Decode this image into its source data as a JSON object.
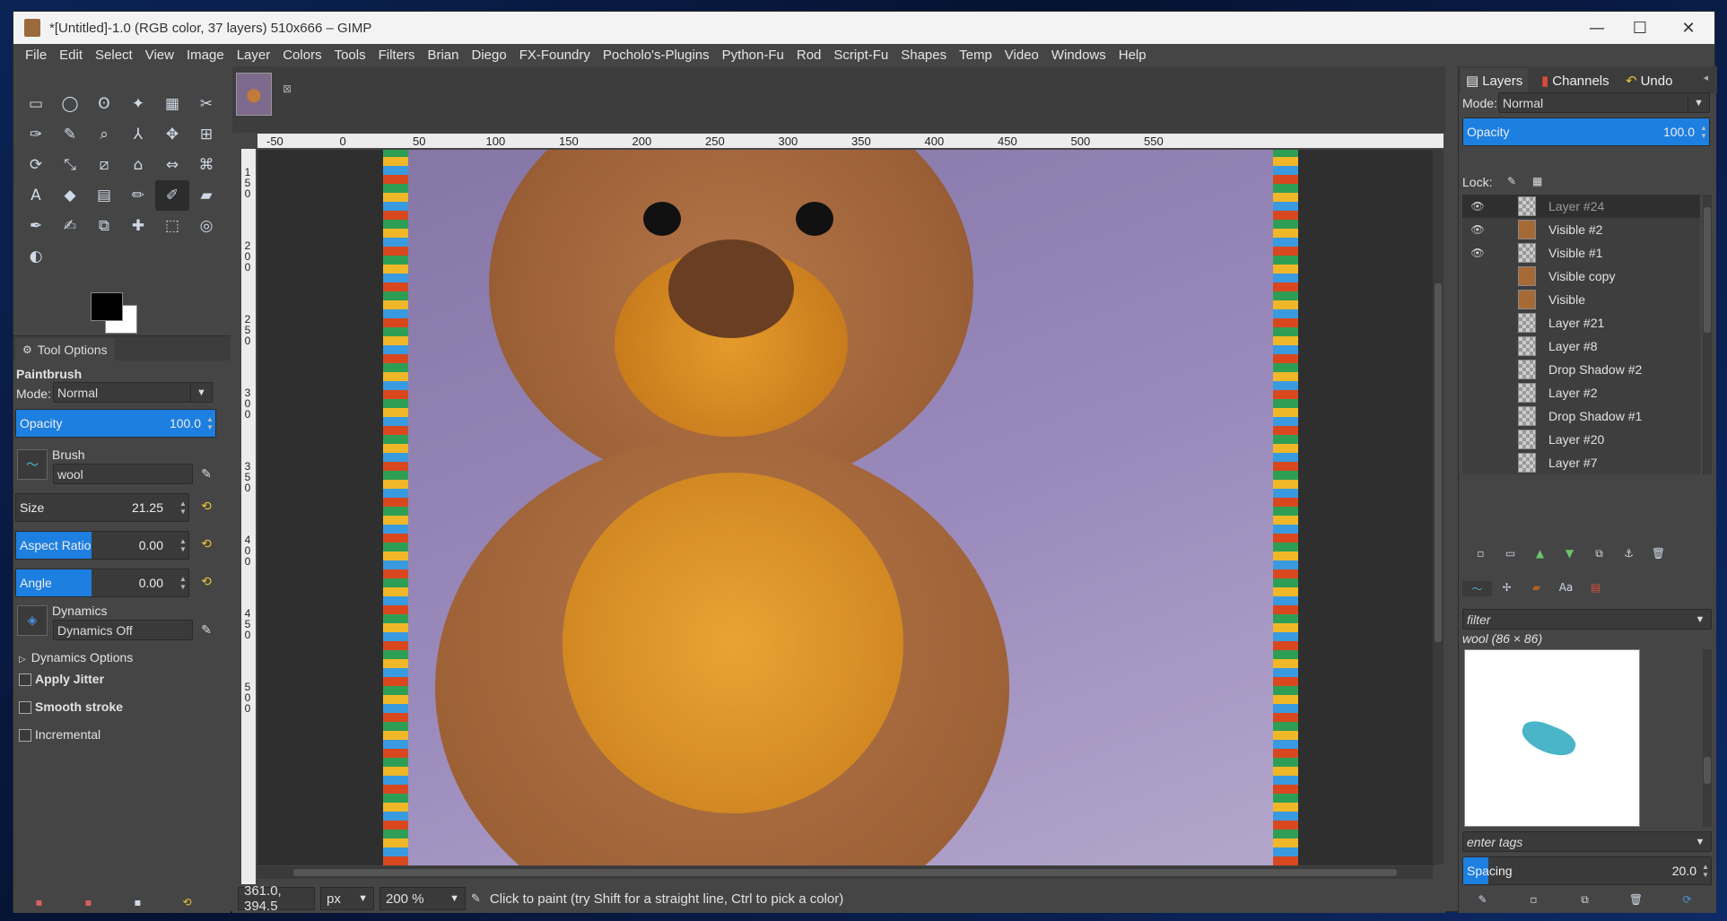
{
  "window": {
    "title": "*[Untitled]-1.0 (RGB color, 37 layers) 510x666 – GIMP",
    "minimize": "—",
    "maximize": "☐",
    "close": "✕"
  },
  "menu": [
    "File",
    "Edit",
    "Select",
    "View",
    "Image",
    "Layer",
    "Colors",
    "Tools",
    "Filters",
    "Brian",
    "Diego",
    "FX-Foundry",
    "Pocholo's-Plugins",
    "Python-Fu",
    "Rod",
    "Script-Fu",
    "Shapes",
    "Temp",
    "Video",
    "Windows",
    "Help"
  ],
  "toolbox": {
    "tools": [
      "rect-select-icon",
      "ellipse-select-icon",
      "free-select-icon",
      "fuzzy-select-icon",
      "color-select-icon",
      "scissors-icon",
      "fg-select-icon",
      "paths-icon",
      "color-picker-icon",
      "zoom-icon",
      "measure-icon",
      "move-icon",
      "align-icon",
      "crop-icon",
      "rotate-icon",
      "scale-icon",
      "shear-icon",
      "perspective-icon",
      "flip-icon",
      "cage-icon",
      "warp-icon",
      "text-icon",
      "bucket-fill-icon",
      "gradient-icon",
      "pencil-icon",
      "paintbrush-icon",
      "eraser-icon",
      "airbrush-icon",
      "ink-icon",
      "mypaint-icon",
      "clone-icon",
      "heal-icon",
      "perspective-clone-icon",
      "blur-icon",
      "smudge-icon",
      "dodge-burn-icon"
    ],
    "tool_glyphs": [
      "▭",
      "◯",
      "ʘ",
      "✦",
      "▦",
      "✂",
      "✋",
      "✑",
      "✎",
      "⌕",
      "⅄",
      "✥",
      "⊞",
      "⊡",
      "⟳",
      "⤡",
      "⧄",
      "⌂",
      "⇔",
      "⌘",
      "⌇",
      "A",
      "◆",
      "▤",
      "✏",
      "✐",
      "▰",
      "✢",
      "✒",
      "✍",
      "⧉",
      "✚",
      "⬚",
      "◎",
      "☝",
      "◐"
    ],
    "active_index": 25
  },
  "tool_options": {
    "tab_label": "Tool Options",
    "tool_name": "Paintbrush",
    "mode_label": "Mode:",
    "mode_value": "Normal",
    "opacity": {
      "label": "Opacity",
      "value": "100.0",
      "fraction": 1.0
    },
    "brush_label": "Brush",
    "brush_value": "wool",
    "size": {
      "label": "Size",
      "value": "21.25",
      "fraction": 0.0
    },
    "aspect": {
      "label": "Aspect Ratio",
      "value": "0.00",
      "fraction": 0.44
    },
    "angle": {
      "label": "Angle",
      "value": "0.00",
      "fraction": 0.44
    },
    "dynamics_label": "Dynamics",
    "dynamics_value": "Dynamics Off",
    "dynamics_options": "Dynamics Options",
    "apply_jitter": "Apply Jitter",
    "smooth_stroke": "Smooth stroke",
    "incremental": "Incremental"
  },
  "canvas": {
    "ruler_h": [
      "-50",
      "0",
      "50",
      "100",
      "150",
      "200",
      "250",
      "300",
      "350",
      "400",
      "450",
      "500",
      "550"
    ],
    "ruler_v": [
      "150",
      "200",
      "250",
      "300",
      "350",
      "400",
      "450",
      "500"
    ]
  },
  "status": {
    "coords": "361.0, 394.5",
    "unit": "px",
    "zoom": "200 %",
    "message": "Click to paint (try Shift for a straight line, Ctrl to pick a color)"
  },
  "layers_panel": {
    "tabs": [
      "Layers",
      "Channels",
      "Undo"
    ],
    "mode_label": "Mode:",
    "mode_value": "Normal",
    "opacity": {
      "label": "Opacity",
      "value": "100.0",
      "fraction": 1.0
    },
    "lock_label": "Lock:",
    "layers": [
      {
        "name": "Layer #24",
        "visible": true,
        "thumb": "checker",
        "selected": true
      },
      {
        "name": "Visible #2",
        "visible": true,
        "thumb": "img"
      },
      {
        "name": "Visible #1",
        "visible": true,
        "thumb": "checker"
      },
      {
        "name": "Visible copy",
        "visible": false,
        "thumb": "img"
      },
      {
        "name": "Visible",
        "visible": false,
        "thumb": "img"
      },
      {
        "name": "Layer #21",
        "visible": false,
        "thumb": "checker"
      },
      {
        "name": "Layer #8",
        "visible": false,
        "thumb": "checker"
      },
      {
        "name": "Drop Shadow #2",
        "visible": false,
        "thumb": "checker"
      },
      {
        "name": "Layer #2",
        "visible": false,
        "thumb": "checker"
      },
      {
        "name": "Drop Shadow #1",
        "visible": false,
        "thumb": "checker"
      },
      {
        "name": "Layer #20",
        "visible": false,
        "thumb": "checker"
      },
      {
        "name": "Layer #7",
        "visible": false,
        "thumb": "checker"
      }
    ]
  },
  "brushes_panel": {
    "filter_placeholder": "filter",
    "brush_title": "wool (86 × 86)",
    "tags_placeholder": "enter tags",
    "spacing": {
      "label": "Spacing",
      "value": "20.0",
      "fraction": 0.1
    }
  },
  "colors": {
    "accent": "#1d7fe0",
    "panel": "#454545",
    "chain": "#e8c437"
  }
}
